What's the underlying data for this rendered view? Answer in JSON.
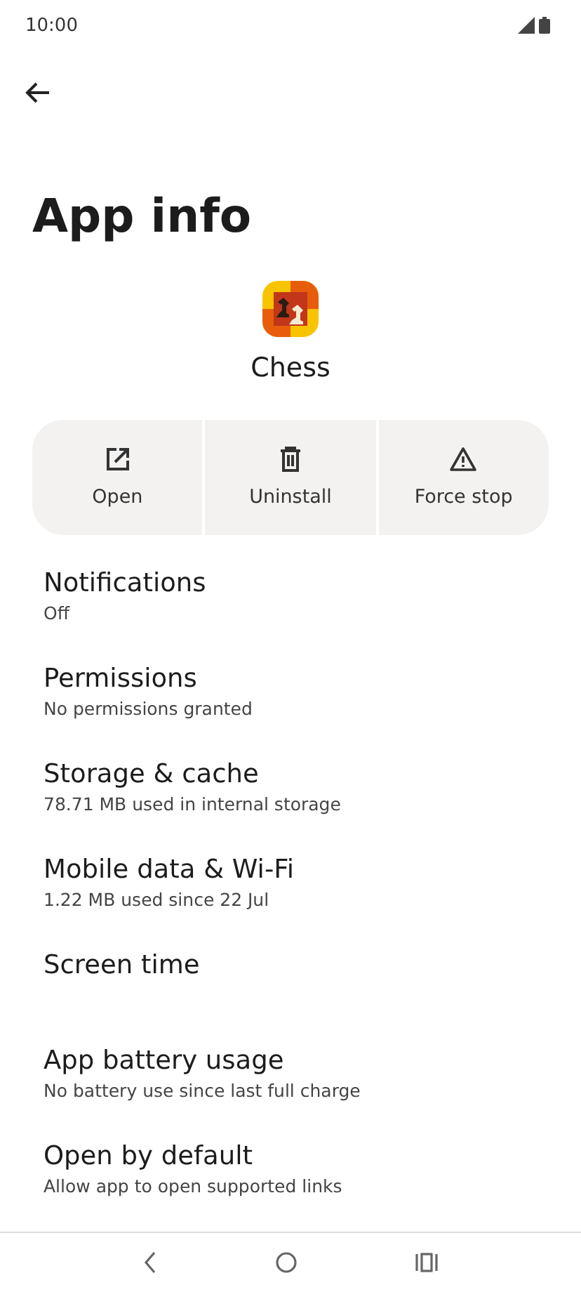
{
  "status_bar": {
    "time": "10:00"
  },
  "title": "App info",
  "app": {
    "name": "Chess"
  },
  "actions": [
    {
      "label": "Open",
      "kind": "open"
    },
    {
      "label": "Uninstall",
      "kind": "uninstall"
    },
    {
      "label": "Force stop",
      "kind": "stop"
    }
  ],
  "settings": [
    {
      "title": "Notifications",
      "subtitle": "Off"
    },
    {
      "title": "Permissions",
      "subtitle": "No permissions granted"
    },
    {
      "title": "Storage & cache",
      "subtitle": "78.71 MB used in internal storage"
    },
    {
      "title": "Mobile data & Wi-Fi",
      "subtitle": "1.22 MB used since 22 Jul"
    },
    {
      "title": "Screen time"
    },
    {
      "title": "App battery usage",
      "subtitle": "No battery use since last full charge"
    },
    {
      "title": "Open by default",
      "subtitle": "Allow app to open supported links"
    }
  ]
}
